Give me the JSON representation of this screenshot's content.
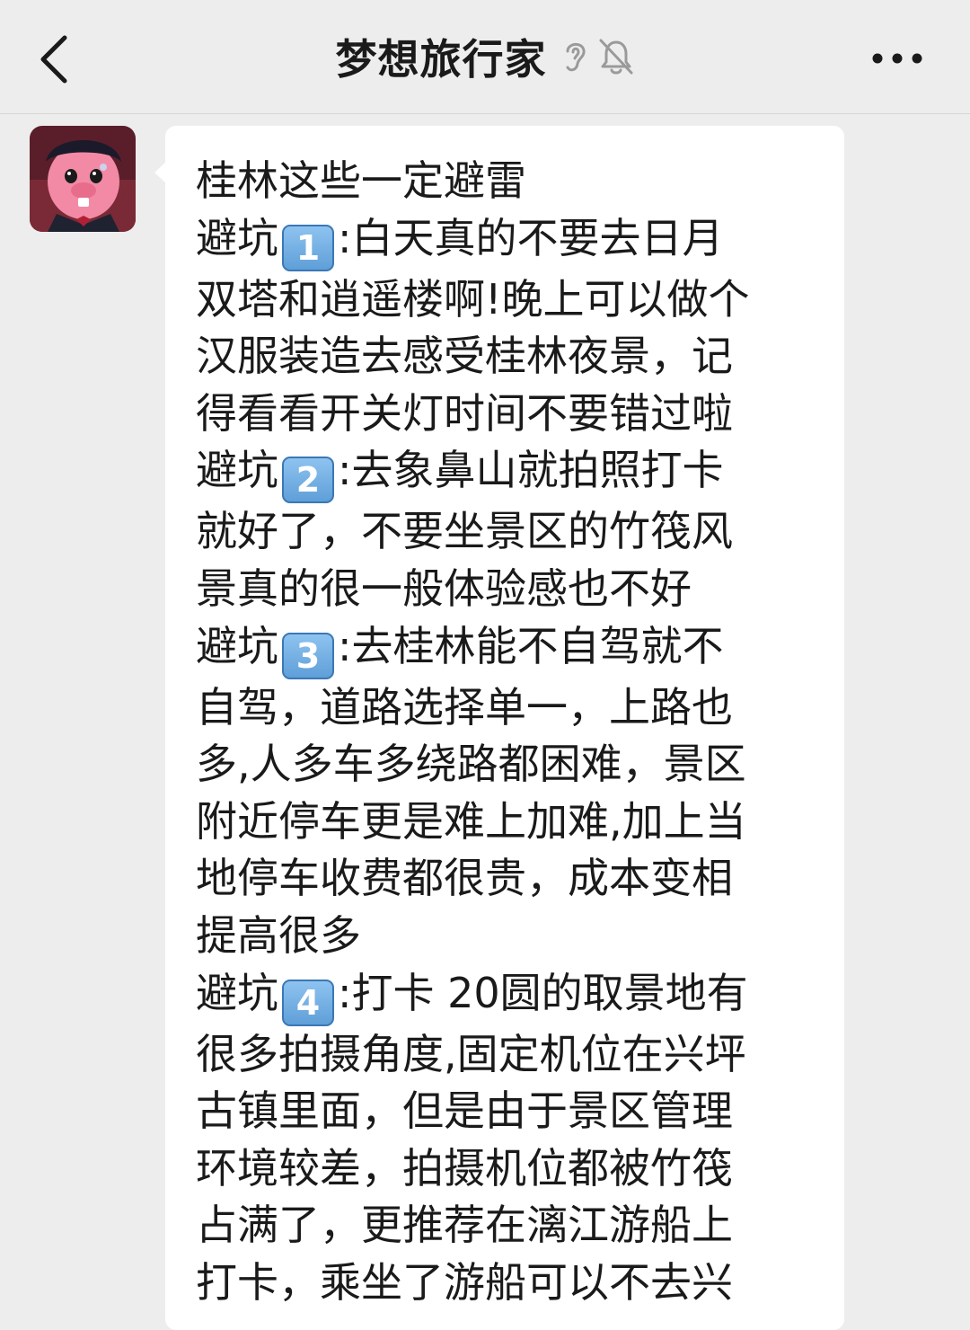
{
  "header": {
    "title": "梦想旅行家",
    "icons": [
      "back-icon",
      "ear-icon",
      "mute-bell-icon",
      "more-icon"
    ]
  },
  "message": {
    "sender_avatar": "pink-cartoon-character-avatar",
    "segments": [
      {
        "line": "桂林这些一定避雷"
      },
      {
        "prefix": "避坑",
        "num": "1",
        "suffix": ":白天真的不要去日月"
      },
      {
        "line": "双塔和逍遥楼啊!晚上可以做个"
      },
      {
        "line": "汉服装造去感受桂林夜景，记"
      },
      {
        "line": "得看看开关灯时间不要错过啦"
      },
      {
        "prefix": "避坑",
        "num": "2",
        "suffix": ":去象鼻山就拍照打卡"
      },
      {
        "line": "就好了，不要坐景区的竹筏风"
      },
      {
        "line": "景真的很一般体验感也不好"
      },
      {
        "prefix": "避坑",
        "num": "3",
        "suffix": ":去桂林能不自驾就不"
      },
      {
        "line": "自驾，道路选择单一，上路也"
      },
      {
        "line": "多,人多车多绕路都困难，景区"
      },
      {
        "line": "附近停车更是难上加难,加上当"
      },
      {
        "line": "地停车收费都很贵，成本变相"
      },
      {
        "line": "提高很多"
      },
      {
        "prefix": "避坑",
        "num": "4",
        "suffix": ":打卡 20圆的取景地有"
      },
      {
        "line": "很多拍摄角度,固定机位在兴坪"
      },
      {
        "line": "古镇里面，但是由于景区管理"
      },
      {
        "line": "环境较差，拍摄机位都被竹筏"
      },
      {
        "line": "占满了，更推荐在漓江游船上"
      },
      {
        "line": "打卡，乘坐了游船可以不去兴"
      }
    ]
  }
}
